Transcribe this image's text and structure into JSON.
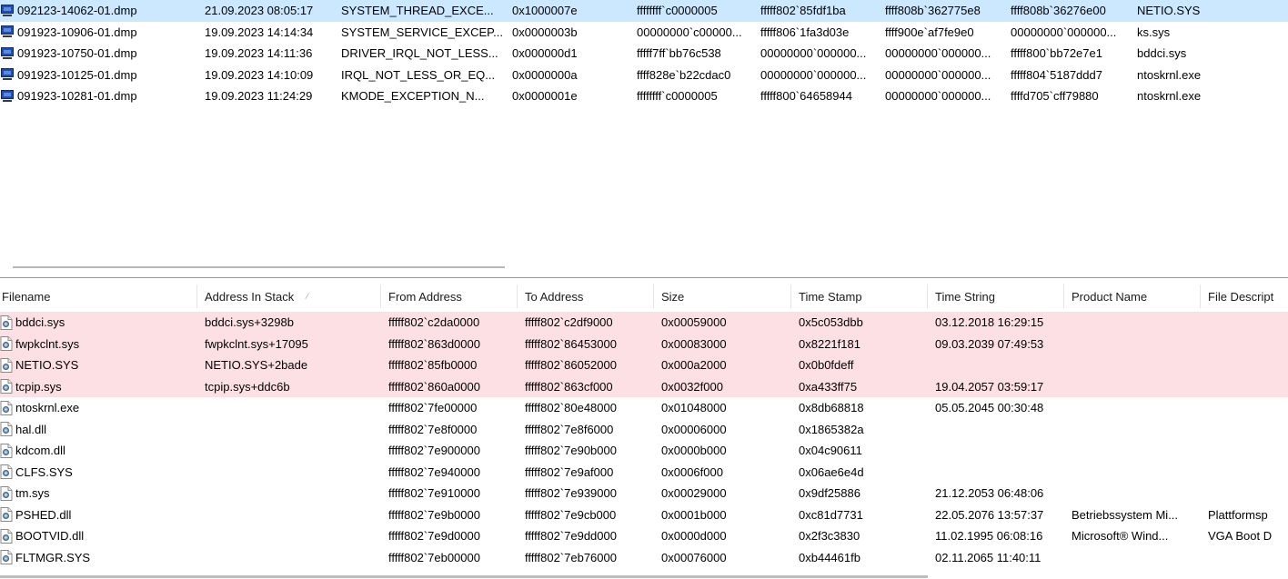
{
  "dumps": [
    {
      "file": "092123-14062-01.dmp",
      "time": "21.09.2023 08:05:17",
      "bug_string": "SYSTEM_THREAD_EXCE...",
      "bug_code": "0x1000007e",
      "p1": "ffffffff`c0000005",
      "p2": "fffff802`85fdf1ba",
      "p3": "ffff808b`362775e8",
      "p4": "ffff808b`36276e00",
      "driver": "NETIO.SYS",
      "selected": true
    },
    {
      "file": "091923-10906-01.dmp",
      "time": "19.09.2023 14:14:34",
      "bug_string": "SYSTEM_SERVICE_EXCEP...",
      "bug_code": "0x0000003b",
      "p1": "00000000`c00000...",
      "p2": "fffff806`1fa3d03e",
      "p3": "ffff900e`af7fe9e0",
      "p4": "00000000`000000...",
      "driver": "ks.sys",
      "selected": false
    },
    {
      "file": "091923-10750-01.dmp",
      "time": "19.09.2023 14:11:36",
      "bug_string": "DRIVER_IRQL_NOT_LESS...",
      "bug_code": "0x000000d1",
      "p1": "fffff7ff`bb76c538",
      "p2": "00000000`000000...",
      "p3": "00000000`000000...",
      "p4": "fffff800`bb72e7e1",
      "driver": "bddci.sys",
      "selected": false
    },
    {
      "file": "091923-10125-01.dmp",
      "time": "19.09.2023 14:10:09",
      "bug_string": "IRQL_NOT_LESS_OR_EQ...",
      "bug_code": "0x0000000a",
      "p1": "ffff828e`b22cdac0",
      "p2": "00000000`000000...",
      "p3": "00000000`000000...",
      "p4": "fffff804`5187ddd7",
      "driver": "ntoskrnl.exe",
      "selected": false
    },
    {
      "file": "091923-10281-01.dmp",
      "time": "19.09.2023 11:24:29",
      "bug_string": "KMODE_EXCEPTION_N...",
      "bug_code": "0x0000001e",
      "p1": "ffffffff`c0000005",
      "p2": "fffff800`64658944",
      "p3": "00000000`000000...",
      "p4": "ffffd705`cff79880",
      "driver": "ntoskrnl.exe",
      "selected": false
    }
  ],
  "columns": {
    "filename": "Filename",
    "address_in_stack": "Address In Stack",
    "from_address": "From Address",
    "to_address": "To Address",
    "size": "Size",
    "time_stamp": "Time Stamp",
    "time_string": "Time String",
    "product_name": "Product Name",
    "file_description": "File Descript"
  },
  "drivers": [
    {
      "name": "bddci.sys",
      "stack": "bddci.sys+3298b",
      "from": "fffff802`c2da0000",
      "to": "fffff802`c2df9000",
      "size": "0x00059000",
      "stamp": "0x5c053dbb",
      "tstr": "03.12.2018 16:29:15",
      "product": "",
      "desc": "",
      "highlight": true
    },
    {
      "name": "fwpkclnt.sys",
      "stack": "fwpkclnt.sys+17095",
      "from": "fffff802`863d0000",
      "to": "fffff802`86453000",
      "size": "0x00083000",
      "stamp": "0x8221f181",
      "tstr": "09.03.2039 07:49:53",
      "product": "",
      "desc": "",
      "highlight": true
    },
    {
      "name": "NETIO.SYS",
      "stack": "NETIO.SYS+2bade",
      "from": "fffff802`85fb0000",
      "to": "fffff802`86052000",
      "size": "0x000a2000",
      "stamp": "0x0b0fdeff",
      "tstr": "",
      "product": "",
      "desc": "",
      "highlight": true
    },
    {
      "name": "tcpip.sys",
      "stack": "tcpip.sys+ddc6b",
      "from": "fffff802`860a0000",
      "to": "fffff802`863cf000",
      "size": "0x0032f000",
      "stamp": "0xa433ff75",
      "tstr": "19.04.2057 03:59:17",
      "product": "",
      "desc": "",
      "highlight": true
    },
    {
      "name": "ntoskrnl.exe",
      "stack": "",
      "from": "fffff802`7fe00000",
      "to": "fffff802`80e48000",
      "size": "0x01048000",
      "stamp": "0x8db68818",
      "tstr": "05.05.2045 00:30:48",
      "product": "",
      "desc": "",
      "highlight": false
    },
    {
      "name": "hal.dll",
      "stack": "",
      "from": "fffff802`7e8f0000",
      "to": "fffff802`7e8f6000",
      "size": "0x00006000",
      "stamp": "0x1865382a",
      "tstr": "",
      "product": "",
      "desc": "",
      "highlight": false
    },
    {
      "name": "kdcom.dll",
      "stack": "",
      "from": "fffff802`7e900000",
      "to": "fffff802`7e90b000",
      "size": "0x0000b000",
      "stamp": "0x04c90611",
      "tstr": "",
      "product": "",
      "desc": "",
      "highlight": false
    },
    {
      "name": "CLFS.SYS",
      "stack": "",
      "from": "fffff802`7e940000",
      "to": "fffff802`7e9af000",
      "size": "0x0006f000",
      "stamp": "0x06ae6e4d",
      "tstr": "",
      "product": "",
      "desc": "",
      "highlight": false
    },
    {
      "name": "tm.sys",
      "stack": "",
      "from": "fffff802`7e910000",
      "to": "fffff802`7e939000",
      "size": "0x00029000",
      "stamp": "0x9df25886",
      "tstr": "21.12.2053 06:48:06",
      "product": "",
      "desc": "",
      "highlight": false
    },
    {
      "name": "PSHED.dll",
      "stack": "",
      "from": "fffff802`7e9b0000",
      "to": "fffff802`7e9cb000",
      "size": "0x0001b000",
      "stamp": "0xc81d7731",
      "tstr": "22.05.2076 13:57:37",
      "product": "Betriebssystem Mi...",
      "desc": "Plattformsp",
      "highlight": false
    },
    {
      "name": "BOOTVID.dll",
      "stack": "",
      "from": "fffff802`7e9d0000",
      "to": "fffff802`7e9dd000",
      "size": "0x0000d000",
      "stamp": "0x2f3c3830",
      "tstr": "11.02.1995 06:08:16",
      "product": "Microsoft® Wind...",
      "desc": "VGA Boot D",
      "highlight": false
    },
    {
      "name": "FLTMGR.SYS",
      "stack": "",
      "from": "fffff802`7eb00000",
      "to": "fffff802`7eb76000",
      "size": "0x00076000",
      "stamp": "0xb44461fb",
      "tstr": "02.11.2065 11:40:11",
      "product": "",
      "desc": "",
      "highlight": false
    }
  ],
  "icons": {
    "dump_file": "computer-icon",
    "driver_file": "driver-file-icon"
  },
  "colors": {
    "selected_row": "#cce8ff",
    "highlight_row": "#fde0e3"
  }
}
